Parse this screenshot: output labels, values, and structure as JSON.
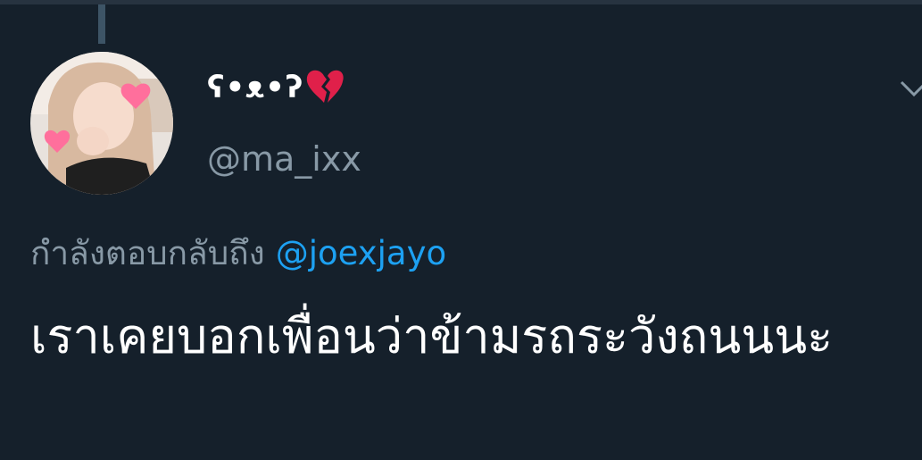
{
  "tweet": {
    "author": {
      "display_name": "ʕ•ᴥ•ʔ",
      "display_emoji": "broken-heart-emoji",
      "handle": "@ma_ixx",
      "avatar": "profile-photo"
    },
    "reply_prefix": "กำลังตอบกลับถึง",
    "reply_to": "@joexjayo",
    "text": "เราเคยบอกเพื่อนว่าข้ามรถระวังถนนนะ",
    "menu_icon": "chevron-down-icon"
  },
  "colors": {
    "background": "#15202b",
    "secondary_text": "#8899a6",
    "link": "#1da1f2",
    "thread_line": "#3d5466"
  }
}
